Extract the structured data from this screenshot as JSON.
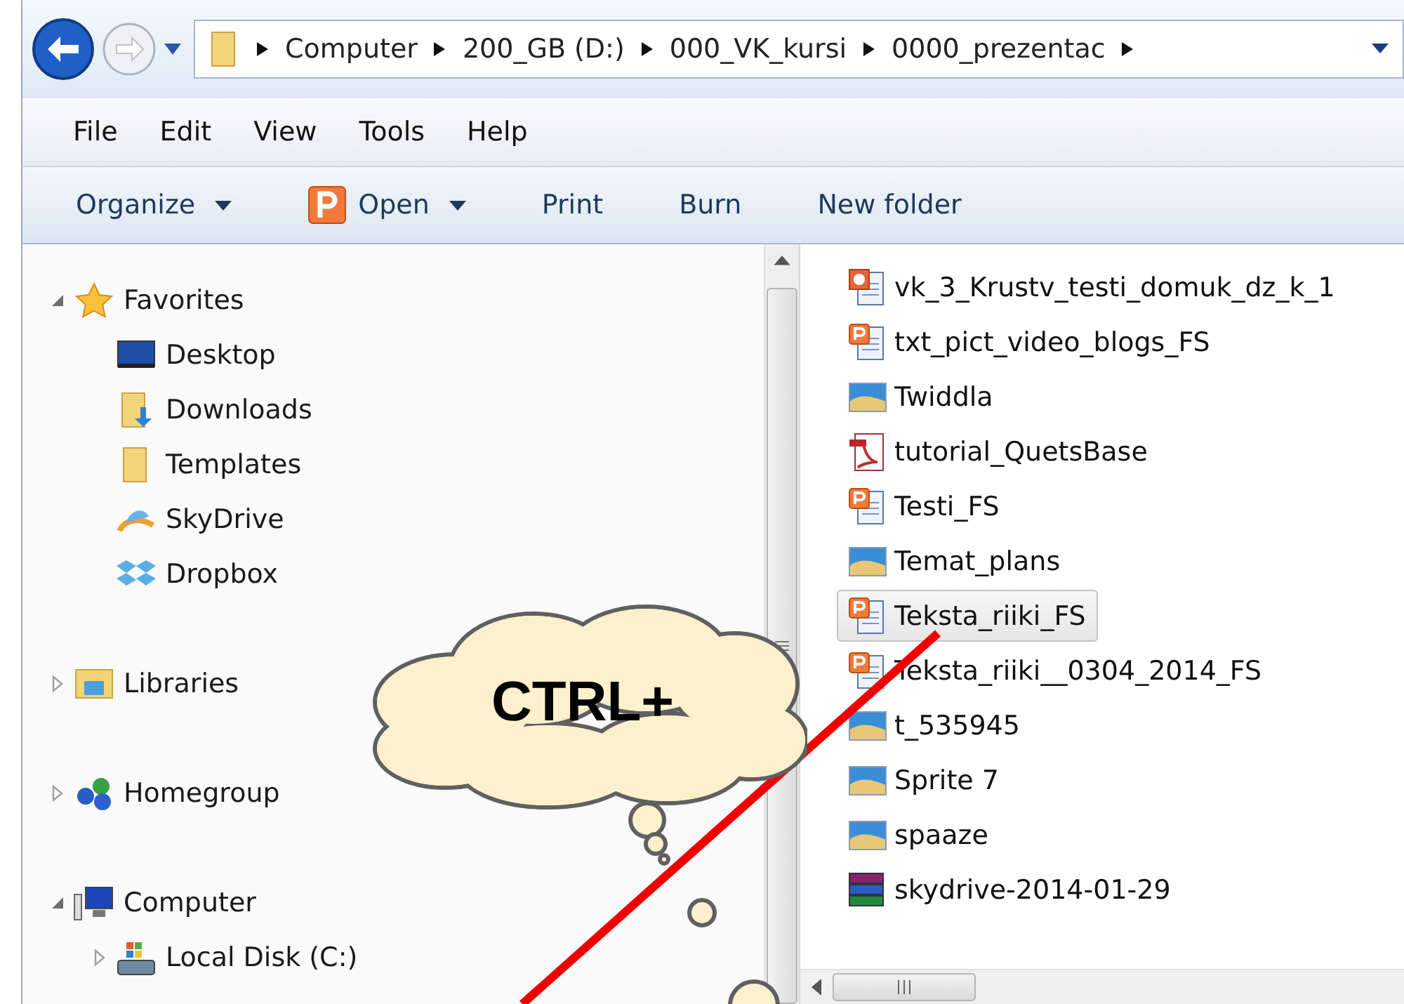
{
  "address": {
    "crumbs": [
      "Computer",
      "200_GB (D:)",
      "000_VK_kursi",
      "0000_prezentac"
    ]
  },
  "menu": [
    "File",
    "Edit",
    "View",
    "Tools",
    "Help"
  ],
  "toolbar": [
    {
      "label": "Organize",
      "kind": "menu"
    },
    {
      "label": "Open",
      "kind": "open-menu"
    },
    {
      "label": "Print",
      "kind": "plain"
    },
    {
      "label": "Burn",
      "kind": "plain"
    },
    {
      "label": "New folder",
      "kind": "plain"
    }
  ],
  "nav": [
    {
      "label": "Favorites",
      "expanded": true,
      "children": [
        {
          "label": "Desktop"
        },
        {
          "label": "Downloads"
        },
        {
          "label": "Templates"
        },
        {
          "label": "SkyDrive"
        },
        {
          "label": "Dropbox"
        }
      ]
    },
    {
      "label": "Libraries",
      "expanded": false
    },
    {
      "label": "Homegroup",
      "expanded": false
    },
    {
      "label": "Computer",
      "expanded": true,
      "children": [
        {
          "label": "Local Disk (C:)",
          "expanded": false
        }
      ]
    }
  ],
  "files": [
    {
      "name": "vk_3_Krustv_testi_domuk_dz_k_1",
      "kind": "slideshow",
      "selected": false
    },
    {
      "name": "txt_pict_video_blogs_FS",
      "kind": "presentation",
      "selected": false
    },
    {
      "name": "Twiddla",
      "kind": "image",
      "selected": false
    },
    {
      "name": "tutorial_QuetsBase",
      "kind": "pdf",
      "selected": false
    },
    {
      "name": "Testi_FS",
      "kind": "presentation",
      "selected": false
    },
    {
      "name": "Temat_plans",
      "kind": "image",
      "selected": false
    },
    {
      "name": "Teksta_riiki_FS",
      "kind": "presentation",
      "selected": true
    },
    {
      "name": "Teksta_riiki__0304_2014_FS",
      "kind": "presentation",
      "selected": false
    },
    {
      "name": "t_535945",
      "kind": "image",
      "selected": false
    },
    {
      "name": "Sprite 7",
      "kind": "image",
      "selected": false
    },
    {
      "name": "spaaze",
      "kind": "image",
      "selected": false
    },
    {
      "name": "skydrive-2014-01-29",
      "kind": "archive",
      "selected": false
    }
  ],
  "callout": {
    "text": "CTRL+"
  }
}
